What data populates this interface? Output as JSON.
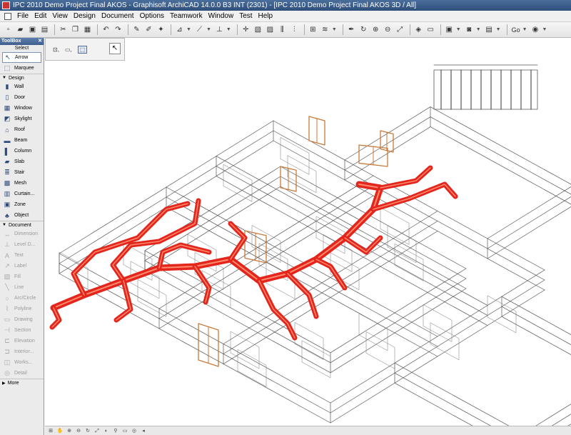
{
  "window": {
    "title": "IPC 2010 Demo Project Final AKOS - Graphisoft ArchiCAD 14.0.0 B3 INT (2301) - [IPC 2010 Demo Project Final AKOS 3D / All]"
  },
  "menu": [
    "File",
    "Edit",
    "View",
    "Design",
    "Document",
    "Options",
    "Teamwork",
    "Window",
    "Test",
    "Help"
  ],
  "toolbar": {
    "go_label": "Go"
  },
  "toolbox": {
    "title": "ToolBox",
    "select_label": "Select",
    "select_tools": [
      {
        "label": "Arrow",
        "icon": "arrow-icon",
        "glyph": "↖",
        "active": true
      },
      {
        "label": "Marquee",
        "icon": "marquee-icon",
        "glyph": "⬚",
        "active": false
      }
    ],
    "design_label": "Design",
    "design_tools": [
      {
        "label": "Wall",
        "icon": "wall-icon",
        "glyph": "▮"
      },
      {
        "label": "Door",
        "icon": "door-icon",
        "glyph": "▯"
      },
      {
        "label": "Window",
        "icon": "window-icon",
        "glyph": "▦"
      },
      {
        "label": "Skylight",
        "icon": "skylight-icon",
        "glyph": "◩"
      },
      {
        "label": "Roof",
        "icon": "roof-icon",
        "glyph": "⌂"
      },
      {
        "label": "Beam",
        "icon": "beam-icon",
        "glyph": "▬"
      },
      {
        "label": "Column",
        "icon": "column-icon",
        "glyph": "▌"
      },
      {
        "label": "Slab",
        "icon": "slab-icon",
        "glyph": "▰"
      },
      {
        "label": "Stair",
        "icon": "stair-icon",
        "glyph": "≣"
      },
      {
        "label": "Mesh",
        "icon": "mesh-icon",
        "glyph": "▩"
      },
      {
        "label": "Curtain...",
        "icon": "curtain-wall-icon",
        "glyph": "▥"
      },
      {
        "label": "Zone",
        "icon": "zone-icon",
        "glyph": "▣"
      },
      {
        "label": "Object",
        "icon": "object-icon",
        "glyph": "♣"
      }
    ],
    "document_label": "Document",
    "document_tools": [
      {
        "label": "Dimension",
        "icon": "dimension-icon",
        "glyph": "↔"
      },
      {
        "label": "Level D...",
        "icon": "level-dimension-icon",
        "glyph": "⊥"
      },
      {
        "label": "Text",
        "icon": "text-icon",
        "glyph": "A"
      },
      {
        "label": "Label",
        "icon": "label-icon",
        "glyph": "↗"
      },
      {
        "label": "Fill",
        "icon": "fill-icon",
        "glyph": "▨"
      },
      {
        "label": "Line",
        "icon": "line-icon",
        "glyph": "╲"
      },
      {
        "label": "Arc/Circle",
        "icon": "arc-circle-icon",
        "glyph": "○"
      },
      {
        "label": "Polyline",
        "icon": "polyline-icon",
        "glyph": "⌇"
      },
      {
        "label": "Drawing",
        "icon": "drawing-icon",
        "glyph": "▭"
      },
      {
        "label": "Section",
        "icon": "section-icon",
        "glyph": "⊣"
      },
      {
        "label": "Elevation",
        "icon": "elevation-icon",
        "glyph": "⊏"
      },
      {
        "label": "Interior...",
        "icon": "interior-elevation-icon",
        "glyph": "⊐"
      },
      {
        "label": "Works...",
        "icon": "worksheet-icon",
        "glyph": "◫"
      },
      {
        "label": "Detail",
        "icon": "detail-icon",
        "glyph": "◎"
      }
    ],
    "more_label": "More"
  },
  "colors": {
    "duct": "#e4251c",
    "frame": "#c87a3a",
    "line": "#555555"
  }
}
